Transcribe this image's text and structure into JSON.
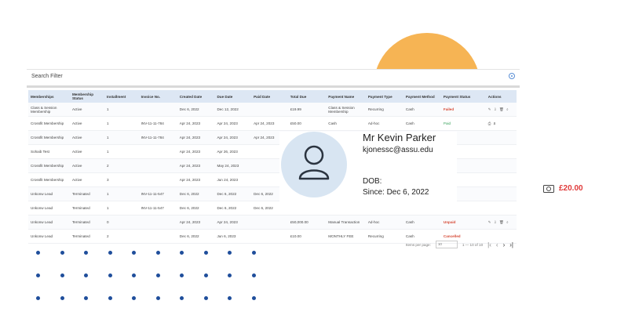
{
  "filter": {
    "title": "Search Filter"
  },
  "table": {
    "headers": [
      "Memberships",
      "Membership Status",
      "Installment",
      "Invoice No.",
      "Created Date",
      "Due Date",
      "Paid Date",
      "Total Due",
      "Payment Name",
      "Payment Type",
      "Payment Method",
      "Payment Status",
      "Actions"
    ],
    "rows": [
      {
        "membership": "Class & Session Membership",
        "status": "Active",
        "installment": "1",
        "invoice": "",
        "created": "Dec 6, 2022",
        "due": "Dec 12, 2022",
        "paid": "",
        "total": "£19.99",
        "pname": "Class & Session Membership",
        "ptype": "Recurring",
        "pmethod": "Cash",
        "pstatus": "Failed",
        "pstatus_class": "status-failed",
        "actions": "✎ ⇩ 🗑 ⌕"
      },
      {
        "membership": "Crossfit Membership",
        "status": "Active",
        "installment": "1",
        "invoice": "INV-11-11-784",
        "created": "Apr 24, 2023",
        "due": "Apr 24, 2023",
        "paid": "Apr 24, 2023",
        "total": "£50.00",
        "pname": "Cash",
        "ptype": "Ad-hoc",
        "pmethod": "Cash",
        "pstatus": "Paid",
        "pstatus_class": "status-paid",
        "actions": "⎙ ⇩"
      },
      {
        "membership": "Crossfit Membership",
        "status": "Active",
        "installment": "1",
        "invoice": "INV-11-11-784",
        "created": "Apr 24, 2023",
        "due": "Apr 24, 2023",
        "paid": "Apr 24, 2023",
        "total": "",
        "pname": "",
        "ptype": "",
        "pmethod": "",
        "pstatus": "",
        "pstatus_class": "",
        "actions": ""
      },
      {
        "membership": "Sohaib Test",
        "status": "Active",
        "installment": "1",
        "invoice": "",
        "created": "Apr 24, 2023",
        "due": "Apr 26, 2023",
        "paid": "",
        "total": "",
        "pname": "",
        "ptype": "",
        "pmethod": "",
        "pstatus": "",
        "pstatus_class": "",
        "actions": ""
      },
      {
        "membership": "Crossfit Membership",
        "status": "Active",
        "installment": "2",
        "invoice": "",
        "created": "Apr 24, 2023",
        "due": "May 24, 2023",
        "paid": "",
        "total": "",
        "pname": "",
        "ptype": "",
        "pmethod": "",
        "pstatus": "",
        "pstatus_class": "",
        "actions": ""
      },
      {
        "membership": "Crossfit Membership",
        "status": "Active",
        "installment": "3",
        "invoice": "",
        "created": "Apr 24, 2023",
        "due": "Jun 24, 2023",
        "paid": "",
        "total": "",
        "pname": "",
        "ptype": "",
        "pmethod": "",
        "pstatus": "",
        "pstatus_class": "",
        "actions": ""
      },
      {
        "membership": "Unkonw Lead",
        "status": "Terminated",
        "installment": "1",
        "invoice": "INV-11-11-547",
        "created": "Dec 6, 2022",
        "due": "Dec 6, 2022",
        "paid": "Dec 6, 2022",
        "total": "",
        "pname": "",
        "ptype": "",
        "pmethod": "",
        "pstatus": "",
        "pstatus_class": "",
        "actions": ""
      },
      {
        "membership": "Unkonw Lead",
        "status": "Terminated",
        "installment": "1",
        "invoice": "INV-11-11-547",
        "created": "Dec 6, 2022",
        "due": "Dec 6, 2022",
        "paid": "Dec 6, 2022",
        "total": "",
        "pname": "",
        "ptype": "",
        "pmethod": "",
        "pstatus": "",
        "pstatus_class": "",
        "actions": ""
      },
      {
        "membership": "Unkonw Lead",
        "status": "Terminated",
        "installment": "0",
        "invoice": "",
        "created": "Apr 24, 2023",
        "due": "Apr 24, 2023",
        "paid": "",
        "total": "£50,000.00",
        "pname": "Manual Transaction",
        "ptype": "Ad-hoc",
        "pmethod": "Cash",
        "pstatus": "Unpaid",
        "pstatus_class": "status-unpaid",
        "actions": "✎ ⇩ 🗑 ⌕"
      },
      {
        "membership": "Unkonw Lead",
        "status": "Terminated",
        "installment": "2",
        "invoice": "",
        "created": "Dec 6, 2022",
        "due": "Jun 6, 2023",
        "paid": "",
        "total": "£10.00",
        "pname": "MONTHLY FEE",
        "ptype": "Recurring",
        "pmethod": "Cash",
        "pstatus": "Cancelled",
        "pstatus_class": "status-cancelled",
        "actions": ""
      }
    ]
  },
  "pager": {
    "items_per_page_label": "Items per page:",
    "items_per_page": "10",
    "range": "1 — 10 of 10",
    "first": "|‹",
    "prev": "‹",
    "next": "›",
    "last": "›|"
  },
  "profile": {
    "name": "Mr Kevin Parker",
    "email": "kjonessc@assu.edu",
    "dob_label": "DOB:",
    "since": "Since: Dec 6, 2022"
  },
  "balance": {
    "amount": "£20.00",
    "icon": "money-icon"
  },
  "colors": {
    "accent_orange": "#f6b454",
    "dot_blue": "#1f4e9b",
    "alert_red": "#e03a3a",
    "avatar_bg": "#d8e5f2",
    "header_bg": "#dde7f4"
  }
}
